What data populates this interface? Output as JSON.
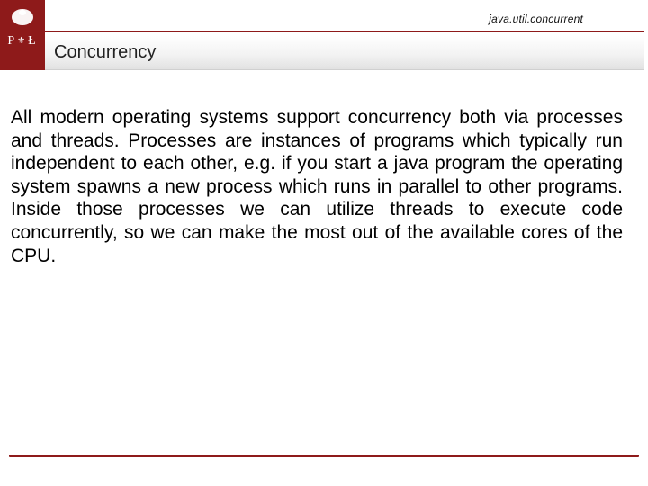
{
  "colors": {
    "accent": "#8e1a1a"
  },
  "header": {
    "breadcrumb": "java.util.concurrent"
  },
  "logo": {
    "letters_left": "P",
    "letters_right": "Ł"
  },
  "title": "Concurrency",
  "body": {
    "paragraph": "All modern operating systems support concurrency both via processes and threads. Processes are instances of programs which typically run independent to each other, e.g. if you start a java program the operating system spawns a new process which runs in parallel to other programs. Inside those processes we can utilize threads to execute code concurrently, so we can make the most out of the available cores of the CPU."
  }
}
